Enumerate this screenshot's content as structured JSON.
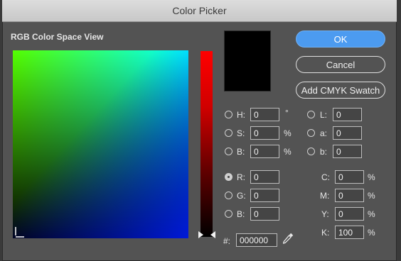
{
  "window": {
    "title": "Color Picker"
  },
  "color_field": {
    "label": "RGB Color Space View"
  },
  "buttons": {
    "ok": "OK",
    "cancel": "Cancel",
    "add_swatch": "Add CMYK Swatch"
  },
  "hsb": {
    "h": {
      "label": "H:",
      "value": "0",
      "unit": "°"
    },
    "s": {
      "label": "S:",
      "value": "0",
      "unit": "%"
    },
    "b": {
      "label": "B:",
      "value": "0",
      "unit": "%"
    }
  },
  "rgb": {
    "r": {
      "label": "R:",
      "value": "0"
    },
    "g": {
      "label": "G:",
      "value": "0"
    },
    "b": {
      "label": "B:",
      "value": "0"
    }
  },
  "lab": {
    "l": {
      "label": "L:",
      "value": "0"
    },
    "a": {
      "label": "a:",
      "value": "0"
    },
    "b": {
      "label": "b:",
      "value": "0"
    }
  },
  "cmyk": {
    "c": {
      "label": "C:",
      "value": "0",
      "unit": "%"
    },
    "m": {
      "label": "M:",
      "value": "0",
      "unit": "%"
    },
    "y": {
      "label": "Y:",
      "value": "0",
      "unit": "%"
    },
    "k": {
      "label": "K:",
      "value": "100",
      "unit": "%"
    }
  },
  "hex": {
    "label": "#:",
    "value": "000000"
  },
  "selected_mode": "R",
  "current_color": "#000000",
  "accent_color": "#4c9bf0",
  "icons": {
    "eyedropper": "eyedropper-icon"
  }
}
